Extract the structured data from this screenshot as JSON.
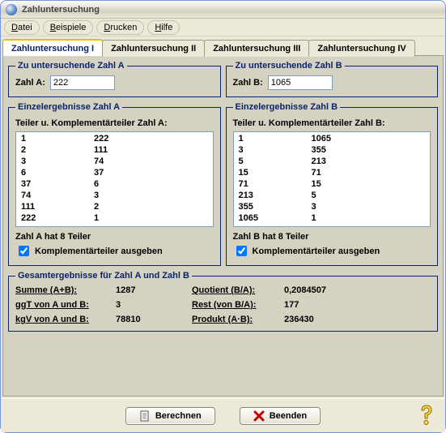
{
  "window": {
    "title": "Zahluntersuchung"
  },
  "menu": {
    "datei": "Datei",
    "beispiele": "Beispiele",
    "drucken": "Drucken",
    "hilfe": "Hilfe"
  },
  "tabs": {
    "t1": "Zahluntersuchung I",
    "t2": "Zahluntersuchung II",
    "t3": "Zahluntersuchung III",
    "t4": "Zahluntersuchung IV"
  },
  "groupA": {
    "legend": "Zu untersuchende Zahl A",
    "label": "Zahl A:",
    "value": "222"
  },
  "groupB": {
    "legend": "Zu untersuchende Zahl B",
    "label": "Zahl B:",
    "value": "1065"
  },
  "resA": {
    "legend": "Einzelergebnisse Zahl A",
    "sub": "Teiler u. Komplementärteiler Zahl A:",
    "rows": [
      {
        "a": "1",
        "b": "222"
      },
      {
        "a": "2",
        "b": "111"
      },
      {
        "a": "3",
        "b": "74"
      },
      {
        "a": "6",
        "b": "37"
      },
      {
        "a": "37",
        "b": "6"
      },
      {
        "a": "74",
        "b": "3"
      },
      {
        "a": "111",
        "b": "2"
      },
      {
        "a": "222",
        "b": "1"
      }
    ],
    "count": "Zahl A hat 8 Teiler",
    "chk": "Komplementärteiler ausgeben"
  },
  "resB": {
    "legend": "Einzelergebnisse Zahl B",
    "sub": "Teiler u. Komplementärteiler Zahl B:",
    "rows": [
      {
        "a": "1",
        "b": "1065"
      },
      {
        "a": "3",
        "b": "355"
      },
      {
        "a": "5",
        "b": "213"
      },
      {
        "a": "15",
        "b": "71"
      },
      {
        "a": "71",
        "b": "15"
      },
      {
        "a": "213",
        "b": "5"
      },
      {
        "a": "355",
        "b": "3"
      },
      {
        "a": "1065",
        "b": "1"
      }
    ],
    "count": "Zahl B hat 8 Teiler",
    "chk": "Komplementärteiler ausgeben"
  },
  "total": {
    "legend": "Gesamtergebnisse für Zahl A und Zahl B",
    "k_sum": "Summe (A+B):",
    "v_sum": "1287",
    "k_ggt": "ggT von A und B:",
    "v_ggt": "3",
    "k_kgv": "kgV von A und B:",
    "v_kgv": "78810",
    "k_quot": "Quotient (B/A):",
    "v_quot": "0,2084507",
    "k_rest": "Rest (von B/A):",
    "v_rest": "177",
    "k_prod": "Produkt (A·B):",
    "v_prod": "236430"
  },
  "footer": {
    "calc": "Berechnen",
    "quit": "Beenden"
  }
}
